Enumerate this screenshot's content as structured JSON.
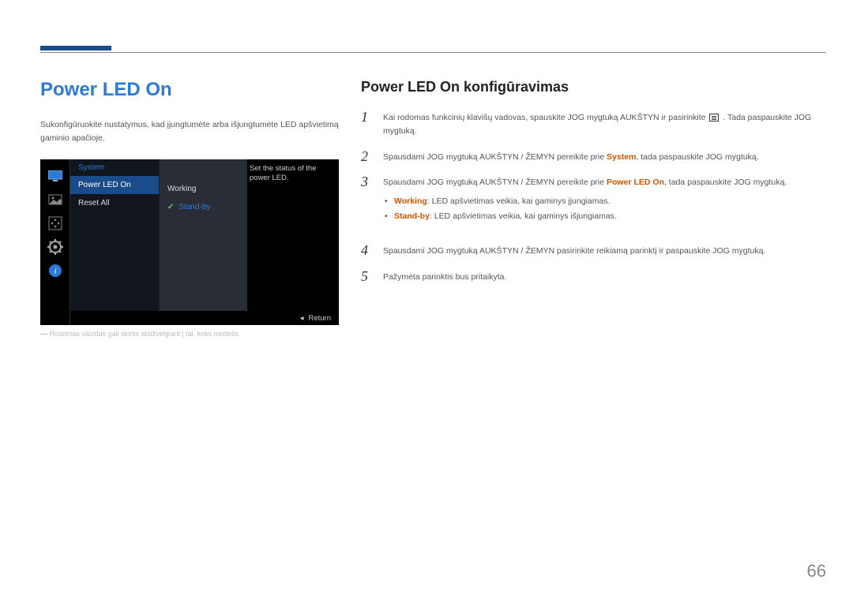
{
  "page_number": "66",
  "left": {
    "title": "Power LED On",
    "intro": "Sukonfigūruokite nustatymus, kad įjungtumėte arba išjungtumėte LED apšvietimą gaminio apačioje.",
    "footnote": "Rodomas vaizdas gali skirtis atsižvelgiant į tai, koks modelis."
  },
  "osd": {
    "menu_title": "System",
    "items": [
      "Power LED On",
      "Reset All"
    ],
    "sub_items": [
      "Working",
      "Stand-by"
    ],
    "info": "Set the status of the power LED.",
    "return": "Return"
  },
  "right": {
    "subtitle": "Power LED On konfigūravimas",
    "steps": [
      {
        "num": "1",
        "pre": "Kai rodomas funkcinių klavišų vadovas, spauskite JOG mygtuką AUKŠTYN ir pasirinkite ",
        "post": ". Tada paspauskite JOG mygtuką."
      },
      {
        "num": "2",
        "pre": "Spausdami JOG mygtuką AUKŠTYN / ŽEMYN pereikite prie ",
        "hl": "System",
        "post": ", tada paspauskite JOG mygtuką."
      },
      {
        "num": "3",
        "pre": "Spausdami JOG mygtuką AUKŠTYN / ŽEMYN pereikite prie ",
        "hl": "Power LED On",
        "post": ", tada paspauskite JOG mygtuką."
      },
      {
        "num": "4",
        "text": "Spausdami JOG mygtuką AUKŠTYN / ŽEMYN pasirinkite reikiamą parinktį ir paspauskite JOG mygtuką."
      },
      {
        "num": "5",
        "text": "Pažymėta parinktis bus pritaikyta."
      }
    ],
    "bullets": [
      {
        "hl": "Working",
        "text": ": LED apšvietimas veikia, kai gaminys įjungiamas."
      },
      {
        "hl": "Stand-by",
        "text": ": LED apšvietimas veikia, kai gaminys išjungiamas."
      }
    ]
  }
}
